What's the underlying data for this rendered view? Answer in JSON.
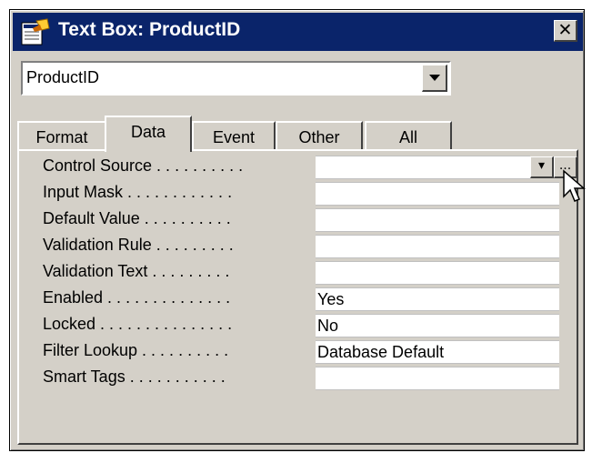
{
  "window": {
    "title": "Text Box: ProductID",
    "close_icon": "close-icon",
    "title_icon": "property-sheet-icon"
  },
  "selector": {
    "value": "ProductID"
  },
  "tabs": [
    {
      "label": "Format"
    },
    {
      "label": "Data"
    },
    {
      "label": "Event"
    },
    {
      "label": "Other"
    },
    {
      "label": "All"
    }
  ],
  "active_tab": "Data",
  "properties": [
    {
      "label": "Control Source . . . . . . . . . .",
      "value": ""
    },
    {
      "label": "Input Mask . . . . . . . . . . . .",
      "value": ""
    },
    {
      "label": "Default Value . . . . . . . . . .",
      "value": ""
    },
    {
      "label": "Validation Rule . . . . . . . . .",
      "value": ""
    },
    {
      "label": "Validation Text . . . . . . . . .",
      "value": ""
    },
    {
      "label": "Enabled . . . . . . . . . . . . . .",
      "value": "Yes"
    },
    {
      "label": "Locked . . . . . . . . . . . . . . .",
      "value": "No"
    },
    {
      "label": "Filter Lookup . . . . . . . . . .",
      "value": "Database Default"
    },
    {
      "label": "Smart Tags . . . . . . . . . . .",
      "value": ""
    }
  ],
  "control_source_buttons": {
    "dropdown_icon": "chevron-down-icon",
    "builder_label": "..."
  }
}
